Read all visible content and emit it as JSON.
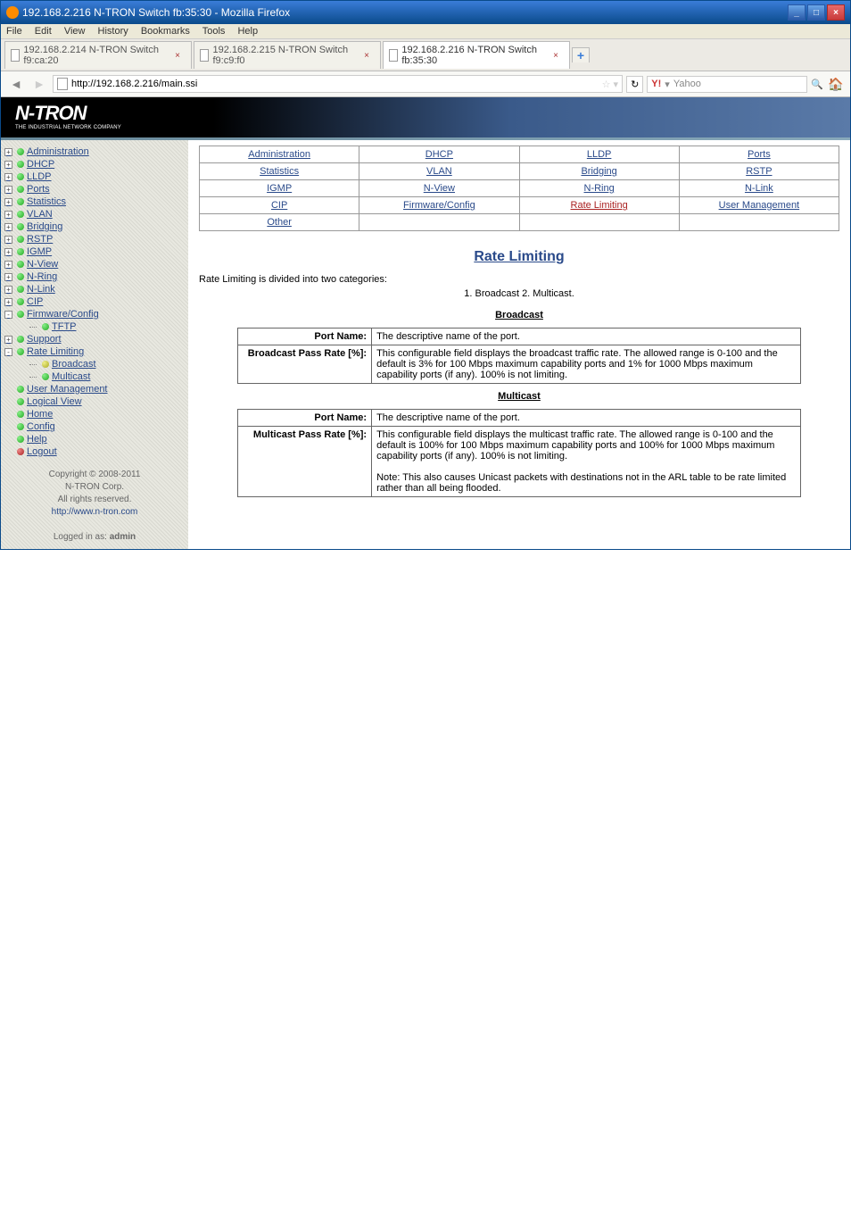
{
  "window_title": "192.168.2.216 N-TRON Switch fb:35:30 - Mozilla Firefox",
  "menubar": [
    "File",
    "Edit",
    "View",
    "History",
    "Bookmarks",
    "Tools",
    "Help"
  ],
  "tabs": [
    {
      "label": "192.168.2.214 N-TRON Switch f9:ca:20",
      "active": false
    },
    {
      "label": "192.168.2.215 N-TRON Switch f9:c9:f0",
      "active": false
    },
    {
      "label": "192.168.2.216 N-TRON Switch fb:35:30",
      "active": true
    }
  ],
  "url": "http://192.168.2.216/main.ssi",
  "search_placeholder": "Yahoo",
  "brand": {
    "name": "N-TRON",
    "sub": "THE INDUSTRIAL NETWORK COMPANY"
  },
  "sidebar": {
    "items": [
      {
        "label": "Administration",
        "bullet": "b-green",
        "exp": "+"
      },
      {
        "label": "DHCP",
        "bullet": "b-green",
        "exp": "+"
      },
      {
        "label": "LLDP",
        "bullet": "b-green",
        "exp": "+"
      },
      {
        "label": "Ports",
        "bullet": "b-green",
        "exp": "+"
      },
      {
        "label": "Statistics",
        "bullet": "b-green",
        "exp": "+"
      },
      {
        "label": "VLAN",
        "bullet": "b-green",
        "exp": "+"
      },
      {
        "label": "Bridging",
        "bullet": "b-green",
        "exp": "+"
      },
      {
        "label": "RSTP",
        "bullet": "b-green",
        "exp": "+"
      },
      {
        "label": "IGMP",
        "bullet": "b-green",
        "exp": "+"
      },
      {
        "label": "N-View",
        "bullet": "b-green",
        "exp": "+"
      },
      {
        "label": "N-Ring",
        "bullet": "b-green",
        "exp": "+"
      },
      {
        "label": "N-Link",
        "bullet": "b-green",
        "exp": "+"
      },
      {
        "label": "CIP",
        "bullet": "b-green",
        "exp": "+"
      },
      {
        "label": "Firmware/Config",
        "bullet": "b-green",
        "exp": "-"
      },
      {
        "label": "TFTP",
        "bullet": "b-green",
        "sub": true
      },
      {
        "label": "Support",
        "bullet": "b-green",
        "exp": "+"
      },
      {
        "label": "Rate Limiting",
        "bullet": "b-green",
        "exp": "-"
      },
      {
        "label": "Broadcast",
        "bullet": "b-yellow",
        "sub": true
      },
      {
        "label": "Multicast",
        "bullet": "b-green",
        "sub": true
      },
      {
        "label": "User Management",
        "bullet": "b-green"
      },
      {
        "label": "Logical View",
        "bullet": "b-green"
      },
      {
        "label": "Home",
        "bullet": "b-green"
      },
      {
        "label": "Config",
        "bullet": "b-green"
      },
      {
        "label": "Help",
        "bullet": "b-green"
      },
      {
        "label": "Logout",
        "bullet": "b-red"
      }
    ],
    "footer": {
      "copyright": "Copyright © 2008-2011",
      "corp": "N-TRON Corp.",
      "rights": "All rights reserved.",
      "url": "http://www.n-tron.com",
      "logged": "Logged in as:",
      "user": "admin"
    }
  },
  "linkgrid": [
    [
      "Administration",
      "DHCP",
      "LLDP",
      "Ports"
    ],
    [
      "Statistics",
      "VLAN",
      "Bridging",
      "RSTP"
    ],
    [
      "IGMP",
      "N-View",
      "N-Ring",
      "N-Link"
    ],
    [
      "CIP",
      "Firmware/Config",
      "Rate Limiting",
      "User Management"
    ],
    [
      "Other",
      "",
      "",
      ""
    ]
  ],
  "page": {
    "title": "Rate Limiting",
    "intro": "Rate Limiting is divided into two categories:",
    "intro_sub": "1. Broadcast   2. Multicast.",
    "broadcast": {
      "head": "Broadcast",
      "rows": [
        {
          "k": "Port Name:",
          "v": "The descriptive name of the port."
        },
        {
          "k": "Broadcast Pass Rate [%]:",
          "v": "This configurable field displays the broadcast traffic rate. The allowed range is 0-100 and the default is 3% for 100 Mbps maximum capability ports and 1% for 1000 Mbps maximum capability ports (if any). 100% is not limiting."
        }
      ]
    },
    "multicast": {
      "head": "Multicast",
      "rows": [
        {
          "k": "Port Name:",
          "v": "The descriptive name of the port."
        },
        {
          "k": "Multicast Pass Rate [%]:",
          "v": "This configurable field displays the multicast traffic rate. The allowed range is 0-100 and the default is 100% for 100 Mbps maximum capability ports and 100% for 1000 Mbps maximum capability ports (if any). 100% is not limiting.\n\nNote: This also causes Unicast packets with destinations not in the ARL table to be rate limited rather than all being flooded."
        }
      ]
    }
  }
}
